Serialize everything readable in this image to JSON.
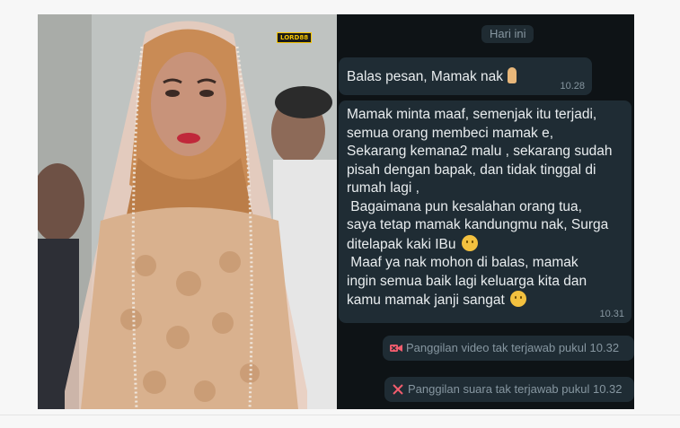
{
  "photo": {
    "logo_text": "LORD88",
    "colors": {
      "hijab": "#c98b55",
      "veil": "#e8c9b8",
      "dress": "#d9b18e",
      "skin": "#c8937a",
      "lips": "#c0283a"
    }
  },
  "chat": {
    "date_chip": "Hari ini",
    "messages": [
      {
        "lines": [
          "Balas pesan, Mamak nak"
        ],
        "emoji": "folded-hands-icon",
        "time": "10.28"
      },
      {
        "lines": [
          "Mamak minta maaf, semenjak itu terjadi,",
          "semua orang membeci mamak e,",
          "Sekarang kemana2 malu , sekarang sudah",
          "pisah dengan bapak, dan tidak tinggal di",
          "rumah lagi ,",
          " Bagaimana pun kesalahan orang tua,",
          "saya tetap mamak kandungmu nak, Surga",
          "ditelapak kaki IBu",
          " Maaf ya nak mohon di balas, mamak",
          "ingin semua baik lagi keluarga kita dan",
          "kamu mamak janji sangat"
        ],
        "time": "10.31"
      }
    ],
    "calls": [
      {
        "label": "Panggilan video tak terjawab pukul 10.32",
        "icon": "missed-video-call-icon"
      },
      {
        "label": "Panggilan suara tak terjawab pukul 10.32",
        "icon": "missed-voice-call-icon"
      }
    ],
    "colors": {
      "background": "#0e1316",
      "bubble": "#1f2c34",
      "missed": "#f15c6d",
      "meta": "#8696a0"
    }
  }
}
